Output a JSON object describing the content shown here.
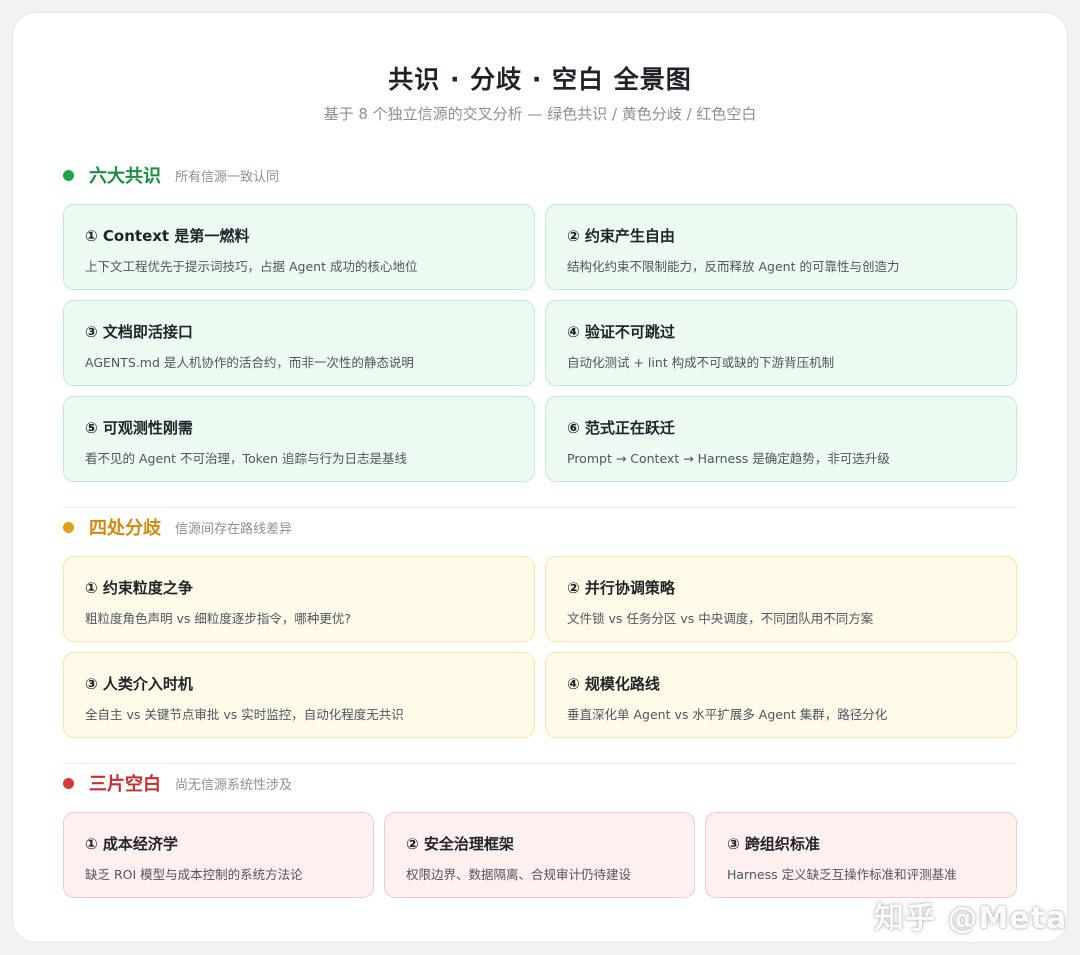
{
  "header": {
    "title": "共识 · 分歧 · 空白 全景图",
    "subtitle": "基于 8 个独立信源的交叉分析 — 绿色共识 / 黄色分歧 / 红色空白"
  },
  "colors": {
    "consensus": "#1fa34a",
    "divergence": "#e0a018",
    "gap": "#d63a3a"
  },
  "consensus": {
    "title": "六大共识",
    "note": "所有信源一致认同",
    "items": [
      {
        "title": "① Context 是第一燃料",
        "desc": "上下文工程优先于提示词技巧，占据 Agent 成功的核心地位"
      },
      {
        "title": "② 约束产生自由",
        "desc": "结构化约束不限制能力，反而释放 Agent 的可靠性与创造力"
      },
      {
        "title": "③ 文档即活接口",
        "desc": "AGENTS.md 是人机协作的活合约，而非一次性的静态说明"
      },
      {
        "title": "④ 验证不可跳过",
        "desc": "自动化测试 + lint 构成不可或缺的下游背压机制"
      },
      {
        "title": "⑤ 可观测性刚需",
        "desc": "看不见的 Agent 不可治理，Token 追踪与行为日志是基线"
      },
      {
        "title": "⑥ 范式正在跃迁",
        "desc": "Prompt → Context → Harness 是确定趋势，非可选升级"
      }
    ]
  },
  "divergence": {
    "title": "四处分歧",
    "note": "信源间存在路线差异",
    "items": [
      {
        "title": "① 约束粒度之争",
        "desc": "粗粒度角色声明 vs 细粒度逐步指令，哪种更优?"
      },
      {
        "title": "② 并行协调策略",
        "desc": "文件锁 vs 任务分区 vs 中央调度，不同团队用不同方案"
      },
      {
        "title": "③ 人类介入时机",
        "desc": "全自主 vs 关键节点审批 vs 实时监控，自动化程度无共识"
      },
      {
        "title": "④ 规模化路线",
        "desc": "垂直深化单 Agent vs 水平扩展多 Agent 集群，路径分化"
      }
    ]
  },
  "gaps": {
    "title": "三片空白",
    "note": "尚无信源系统性涉及",
    "items": [
      {
        "title": "① 成本经济学",
        "desc": "缺乏 ROI 模型与成本控制的系统方法论"
      },
      {
        "title": "② 安全治理框架",
        "desc": "权限边界、数据隔离、合规审计仍待建设"
      },
      {
        "title": "③ 跨组织标准",
        "desc": "Harness 定义缺乏互操作标准和评测基准"
      }
    ]
  },
  "watermark": "知乎 @Meta"
}
